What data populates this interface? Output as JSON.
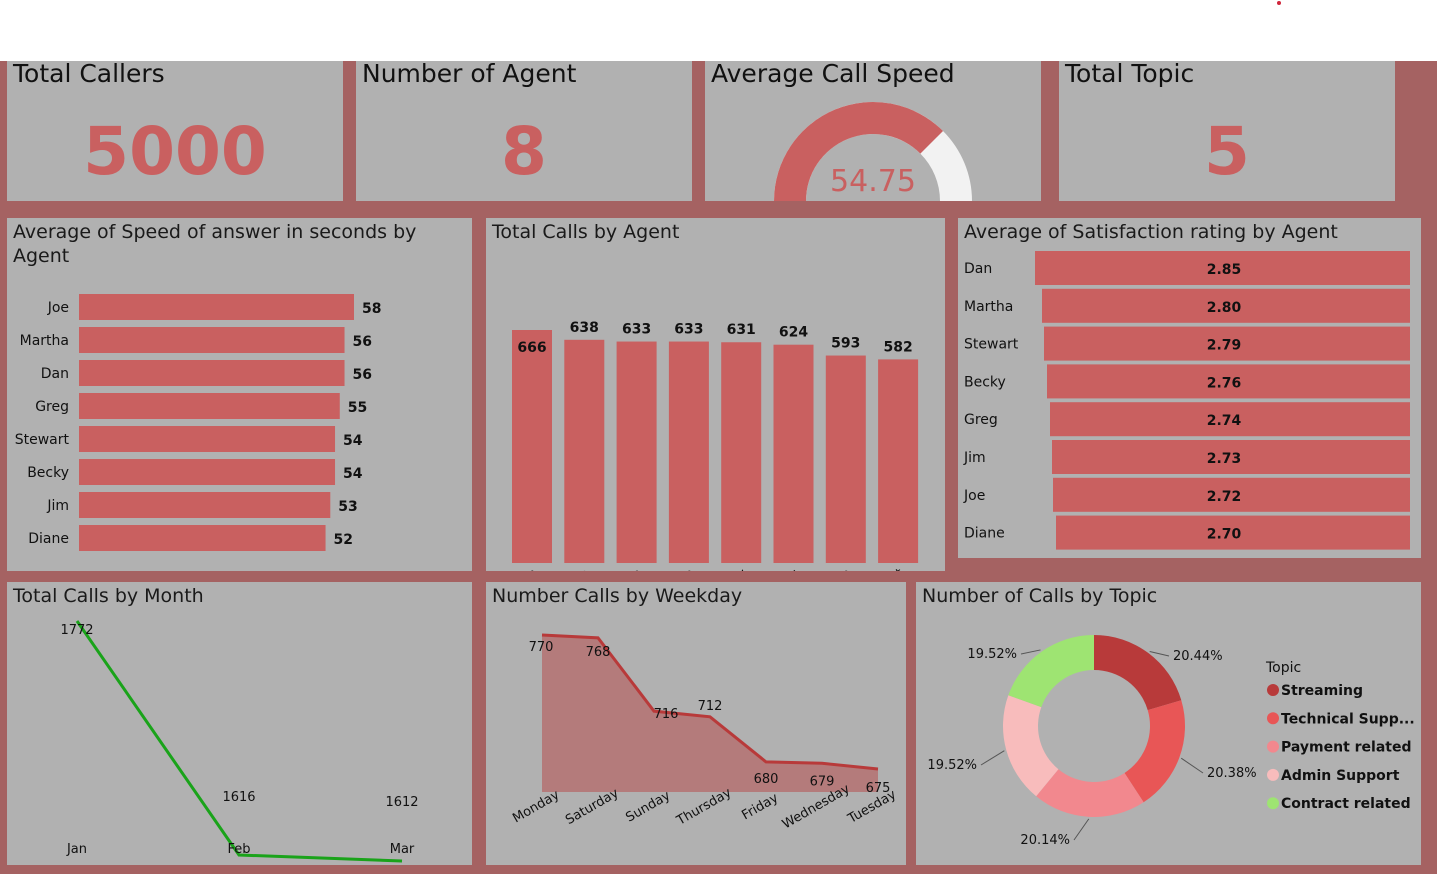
{
  "colors": {
    "bar": "#c96060",
    "accent": "#c96060",
    "green_line": "#1aa31a",
    "area_line": "#b83a3a",
    "area_fill": "#b47b7b",
    "board": "#a56262",
    "panel": "#b1b1b1"
  },
  "kpis": {
    "total_callers": {
      "title": "Total Callers",
      "value": "5000"
    },
    "num_agents": {
      "title": "Number of Agent",
      "value": "8"
    },
    "avg_speed": {
      "title": "Average Call Speed",
      "value": "54.75",
      "gauge_fraction": 0.75
    },
    "total_topic": {
      "title": "Total Topic",
      "value": "5"
    }
  },
  "panels": {
    "speed": {
      "title_line1": "Average of Speed of answer in seconds by",
      "title_line2": "Agent"
    },
    "calls_agent": {
      "title": "Total Calls by Agent"
    },
    "satisfaction": {
      "title": "Average of Satisfaction rating by Agent"
    },
    "month": {
      "title": "Total Calls by Month"
    },
    "weekday": {
      "title": "Number Calls by Weekday"
    },
    "topic": {
      "title": "Number of Calls by Topic"
    }
  },
  "chart_data": [
    {
      "id": "speed",
      "type": "bar",
      "orientation": "horizontal",
      "categories": [
        "Joe",
        "Martha",
        "Dan",
        "Greg",
        "Stewart",
        "Becky",
        "Jim",
        "Diane"
      ],
      "values": [
        58,
        56,
        56,
        55,
        54,
        54,
        53,
        52
      ],
      "xlim": [
        0,
        58
      ]
    },
    {
      "id": "calls_agent",
      "type": "bar",
      "categories": [
        "Jim",
        "Martha",
        "Dan",
        "Diane",
        "Becky",
        "Greg",
        "Joe",
        "Stewart"
      ],
      "values": [
        666,
        638,
        633,
        633,
        631,
        624,
        593,
        582
      ],
      "ylim": [
        0,
        666
      ]
    },
    {
      "id": "satisfaction",
      "type": "bar",
      "orientation": "horizontal",
      "categories": [
        "Dan",
        "Martha",
        "Stewart",
        "Becky",
        "Greg",
        "Jim",
        "Joe",
        "Diane"
      ],
      "values": [
        2.85,
        2.8,
        2.79,
        2.76,
        2.74,
        2.73,
        2.72,
        2.7
      ],
      "labels": [
        "2.85",
        "2.80",
        "2.79",
        "2.76",
        "2.74",
        "2.73",
        "2.72",
        "2.70"
      ]
    },
    {
      "id": "month",
      "type": "line",
      "x": [
        "Jan",
        "Feb",
        "Mar"
      ],
      "values": [
        1772,
        1616,
        1612
      ]
    },
    {
      "id": "weekday",
      "type": "area",
      "x": [
        "Monday",
        "Saturday",
        "Sunday",
        "Thursday",
        "Friday",
        "Wednesday",
        "Tuesday"
      ],
      "values": [
        770,
        768,
        716,
        712,
        680,
        679,
        675
      ]
    },
    {
      "id": "topic",
      "type": "pie",
      "donut": true,
      "legend_title": "Topic",
      "categories": [
        "Streaming",
        "Technical Supp...",
        "Payment related",
        "Admin Support",
        "Contract related"
      ],
      "values": [
        20.44,
        20.38,
        20.14,
        19.52,
        19.52
      ],
      "labels": [
        "20.44%",
        "20.38%",
        "20.14%",
        "19.52%",
        "19.52%"
      ],
      "colors": [
        "#b83a3a",
        "#e85656",
        "#f2888e",
        "#f8bcbc",
        "#9ee472"
      ]
    }
  ]
}
